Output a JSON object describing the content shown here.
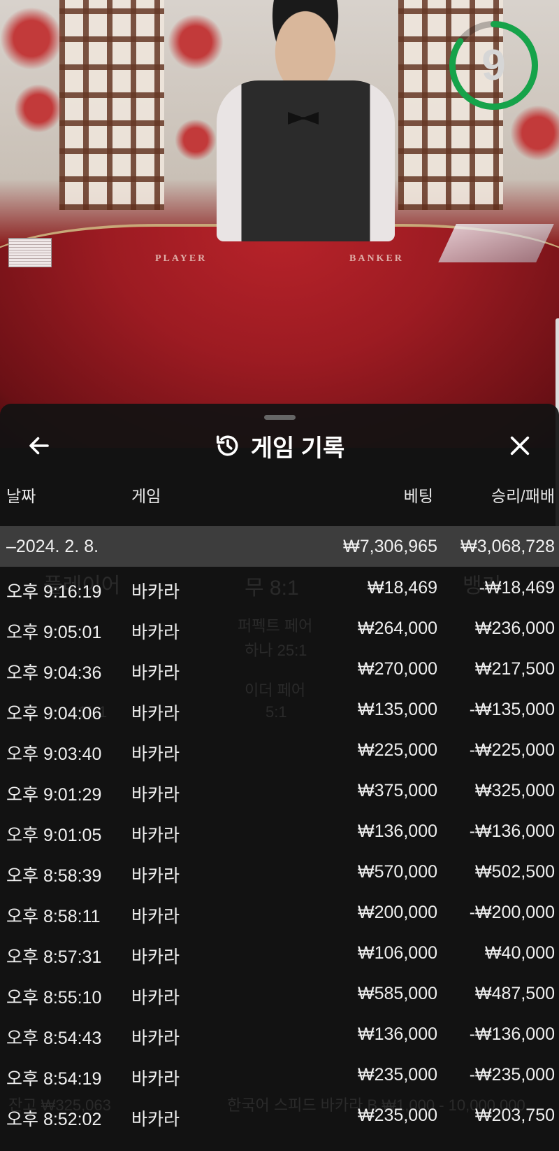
{
  "video": {
    "table_labels": [
      "PLAYER",
      "BANKER"
    ],
    "countdown": "9",
    "countdown_fraction": 0.85,
    "accent_green": "#16a34a"
  },
  "sheet": {
    "title": "게임 기록",
    "icons": {
      "back": "arrow-left-icon",
      "history": "history-clock-icon",
      "close": "close-x-icon"
    },
    "columns": {
      "date": "날짜",
      "game": "게임",
      "bet": "베팅",
      "winloss": "승리/패배"
    },
    "summary": {
      "date": "–2024. 2. 8.",
      "bet": "₩7,306,965",
      "winloss": "₩3,068,728"
    },
    "rows": [
      {
        "time": "오후 9:16:19",
        "game": "바카라",
        "bet": "₩18,469",
        "winloss": "-₩18,469"
      },
      {
        "time": "오후 9:05:01",
        "game": "바카라",
        "bet": "₩264,000",
        "winloss": "₩236,000"
      },
      {
        "time": "오후 9:04:36",
        "game": "바카라",
        "bet": "₩270,000",
        "winloss": "₩217,500"
      },
      {
        "time": "오후 9:04:06",
        "game": "바카라",
        "bet": "₩135,000",
        "winloss": "-₩135,000"
      },
      {
        "time": "오후 9:03:40",
        "game": "바카라",
        "bet": "₩225,000",
        "winloss": "-₩225,000"
      },
      {
        "time": "오후 9:01:29",
        "game": "바카라",
        "bet": "₩375,000",
        "winloss": "₩325,000"
      },
      {
        "time": "오후 9:01:05",
        "game": "바카라",
        "bet": "₩136,000",
        "winloss": "-₩136,000"
      },
      {
        "time": "오후 8:58:39",
        "game": "바카라",
        "bet": "₩570,000",
        "winloss": "₩502,500"
      },
      {
        "time": "오후 8:58:11",
        "game": "바카라",
        "bet": "₩200,000",
        "winloss": "-₩200,000"
      },
      {
        "time": "오후 8:57:31",
        "game": "바카라",
        "bet": "₩106,000",
        "winloss": "₩40,000"
      },
      {
        "time": "오후 8:55:10",
        "game": "바카라",
        "bet": "₩585,000",
        "winloss": "₩487,500"
      },
      {
        "time": "오후 8:54:43",
        "game": "바카라",
        "bet": "₩136,000",
        "winloss": "-₩136,000"
      },
      {
        "time": "오후 8:54:19",
        "game": "바카라",
        "bet": "₩235,000",
        "winloss": "-₩235,000"
      },
      {
        "time": "오후 8:52:02",
        "game": "바카라",
        "bet": "₩235,000",
        "winloss": "₩203,750"
      }
    ]
  },
  "background": {
    "labels": [
      "플레이어",
      "무 8:1",
      "뱅커",
      "퍼펙트 페어",
      "하나 25:1",
      "이더 페어",
      "5:1",
      "11:1",
      "잔고 ₩325,063",
      "한국어 스피드 바카라 B ₩1,000 - 10,000,000"
    ]
  }
}
